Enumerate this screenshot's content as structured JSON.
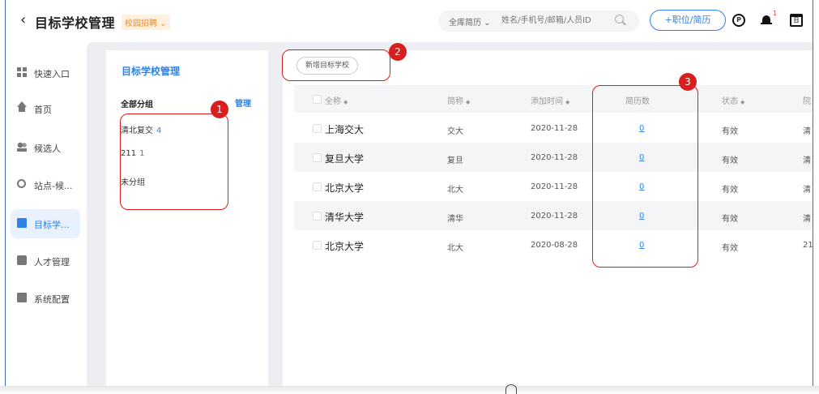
{
  "header": {
    "back_icon": "chevron-left",
    "title": "目标学校管理",
    "tag_label": "校园招聘",
    "search_scope": "全库简历",
    "search_placeholder": "姓名/手机号/邮箱/人员ID",
    "add_button": "+职位/简历",
    "bell_badge": "1",
    "calendar_glyph": "日"
  },
  "sidebar": {
    "items": [
      {
        "label": "快速入口",
        "icon": "grid-icon"
      },
      {
        "label": "首页",
        "icon": "home-icon"
      },
      {
        "label": "候选人",
        "icon": "people-icon"
      },
      {
        "label": "站点-候...",
        "icon": "location-pin-icon"
      },
      {
        "label": "目标学...",
        "icon": "school-icon",
        "active": true
      },
      {
        "label": "人才管理",
        "icon": "card-icon"
      },
      {
        "label": "系统配置",
        "icon": "monitor-icon"
      }
    ]
  },
  "left_panel": {
    "title": "目标学校管理",
    "all_groups": "全部分组",
    "manage": "管理",
    "groups": [
      {
        "name": "清北复交",
        "count": "4"
      },
      {
        "name": "211",
        "count": "1"
      },
      {
        "name": "未分组",
        "count": ""
      }
    ]
  },
  "main": {
    "new_button": "新增目标学校",
    "columns": [
      "全称",
      "简称",
      "添加时间",
      "简历数",
      "状态",
      "院"
    ],
    "sort_mark": "◆",
    "rows": [
      {
        "full_name": "上海交大",
        "short_name": "交大",
        "added": "2020-11-28",
        "resumes": "0",
        "status": "有效",
        "extra": "清"
      },
      {
        "full_name": "复旦大学",
        "short_name": "复旦",
        "added": "2020-11-28",
        "resumes": "0",
        "status": "有效",
        "extra": "清"
      },
      {
        "full_name": "北京大学",
        "short_name": "北大",
        "added": "2020-11-28",
        "resumes": "0",
        "status": "有效",
        "extra": "清"
      },
      {
        "full_name": "清华大学",
        "short_name": "清华",
        "added": "2020-11-28",
        "resumes": "0",
        "status": "有效",
        "extra": "清"
      },
      {
        "full_name": "北京大学",
        "short_name": "北大",
        "added": "2020-08-28",
        "resumes": "0",
        "status": "有效",
        "extra": "21"
      }
    ]
  },
  "annotations": [
    "1",
    "2",
    "3"
  ],
  "colors": {
    "accent": "#2f83e8",
    "annotation": "#d81e1e",
    "tag": "#f08a24"
  }
}
